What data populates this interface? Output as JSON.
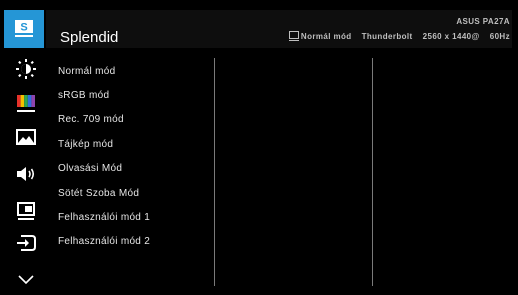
{
  "header": {
    "title": "Splendid",
    "model": "ASUS PA27A",
    "status_mode": "Normál mód",
    "status_input": "Thunderbolt",
    "status_resolution": "2560 x 1440@",
    "status_refresh": "60Hz"
  },
  "sidebar": {
    "items": [
      {
        "icon": "splendid-s-icon",
        "label": "S",
        "active": true
      },
      {
        "icon": "brightness-icon"
      },
      {
        "icon": "color-bars-icon"
      },
      {
        "icon": "image-icon"
      },
      {
        "icon": "sound-icon"
      },
      {
        "icon": "pip-icon"
      },
      {
        "icon": "input-select-icon"
      },
      {
        "icon": "chevron-down-icon"
      }
    ]
  },
  "menu": {
    "items": [
      "Normál mód",
      "sRGB mód",
      "Rec. 709 mód",
      "Tájkép mód",
      "Olvasási Mód",
      "Sötét Szoba Mód",
      "Felhasználói mód 1",
      "Felhasználói mód 2"
    ]
  },
  "colors": {
    "accent": "#2596d6",
    "background": "#000000",
    "text": "#e6e6e6",
    "dim_text": "#bfbfbf",
    "divider": "#7a7a7a"
  }
}
